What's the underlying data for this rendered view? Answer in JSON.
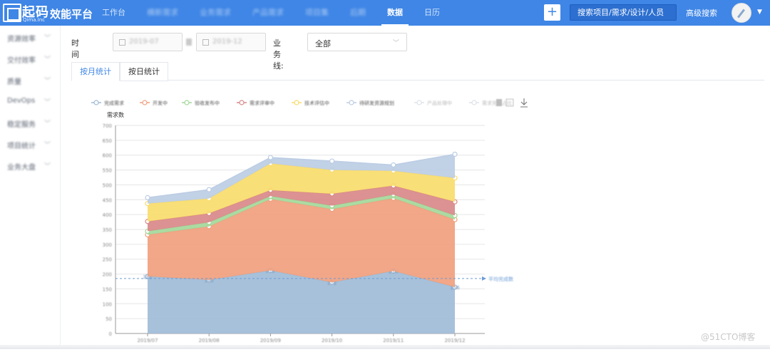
{
  "brand": {
    "name_cn": "起码",
    "name_en": "Qima.Inc",
    "app_name": "效能平台"
  },
  "nav": {
    "items": [
      {
        "label": "工作台",
        "blurred": false,
        "active": false
      },
      {
        "label": "横新需求",
        "blurred": true,
        "active": false
      },
      {
        "label": "业务需求",
        "blurred": true,
        "active": false
      },
      {
        "label": "产品需求",
        "blurred": true,
        "active": false
      },
      {
        "label": "项目集",
        "blurred": true,
        "active": false
      },
      {
        "label": "后期",
        "blurred": true,
        "active": false
      },
      {
        "label": "数据",
        "blurred": false,
        "active": true
      },
      {
        "label": "日历",
        "blurred": false,
        "active": false
      }
    ],
    "plus_label": "+",
    "search_placeholder": "搜索项目/需求/设计/人员",
    "advanced_search": "高级搜索"
  },
  "sidebar": {
    "items": [
      {
        "label": "资源效率"
      },
      {
        "label": "交付效率"
      },
      {
        "label": "质量"
      },
      {
        "label": "DevOps"
      },
      {
        "label": "稳定服务"
      },
      {
        "label": "项目统计"
      },
      {
        "label": "业务大盘"
      }
    ]
  },
  "filters": {
    "time_label": "时间区间:",
    "start_date": "2019-07",
    "end_date": "2019-12",
    "business_label": "业务线:",
    "business_value": "全部"
  },
  "tabs": [
    {
      "label": "按月统计",
      "active": true
    },
    {
      "label": "按日统计",
      "active": false
    }
  ],
  "watermark": "@51CTO博客",
  "chart_data": {
    "type": "area",
    "stacked": true,
    "ylabel": "需求数",
    "ylim": [
      0,
      700
    ],
    "yticks": [
      0,
      50,
      100,
      150,
      200,
      250,
      300,
      350,
      400,
      450,
      500,
      550,
      600,
      650,
      700
    ],
    "categories": [
      "2019/07",
      "2019/08",
      "2019/09",
      "2019/10",
      "2019/11",
      "2019/12"
    ],
    "legend_position": "top",
    "series": [
      {
        "name": "完成需求",
        "color": "#9fbcd8",
        "values": [
          192,
          180,
          212,
          172,
          210,
          156
        ]
      },
      {
        "name": "开发中",
        "color": "#f0a07e",
        "values": [
          140,
          180,
          240,
          246,
          245,
          227
        ]
      },
      {
        "name": "验收发布中",
        "color": "#a4d89a",
        "values": [
          12,
          14,
          10,
          12,
          12,
          14
        ]
      },
      {
        "name": "需求评审中",
        "color": "#d98989",
        "values": [
          33,
          30,
          20,
          40,
          30,
          46
        ]
      },
      {
        "name": "技术评估中",
        "color": "#f8dc6c",
        "values": [
          60,
          50,
          90,
          80,
          50,
          80
        ]
      },
      {
        "name": "待研发资源规划",
        "color": "#bccde4",
        "values": [
          20,
          30,
          20,
          30,
          20,
          80
        ]
      },
      {
        "name": "产品处理中",
        "color": "#dde3ea",
        "values": [
          0,
          0,
          0,
          0,
          0,
          0
        ]
      },
      {
        "name": "需求完成占比",
        "color": "#dde3ea",
        "values": [
          0,
          0,
          0,
          0,
          0,
          0
        ]
      }
    ],
    "markline": {
      "value": 185,
      "label": "平均完成数"
    }
  }
}
